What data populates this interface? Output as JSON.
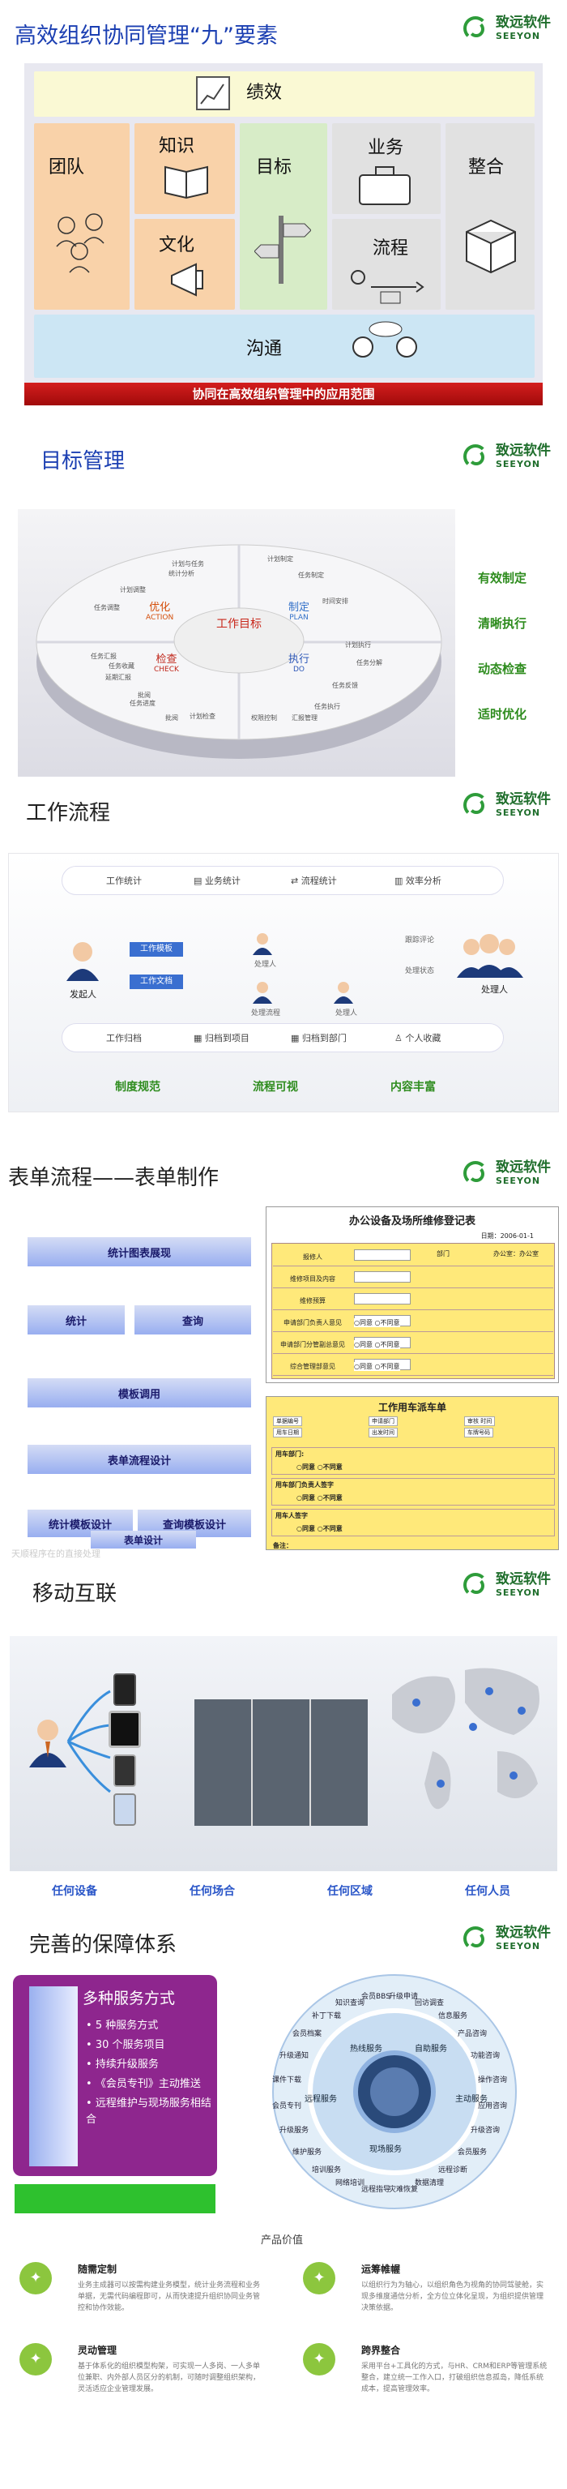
{
  "logo": {
    "cn": "致远软件",
    "en": "SEEYON"
  },
  "s1": {
    "title": "高效组织协同管理“九”要素",
    "perf": "绩效",
    "team": "团队",
    "knowledge": "知识",
    "culture": "文化",
    "goal": "目标",
    "business": "业务",
    "process": "流程",
    "integration": "整合",
    "comm": "沟通",
    "banner": "协同在高效组织管理中的应用范围"
  },
  "s2": {
    "title": "目标管理",
    "center": "工作目标",
    "optimize": "优化",
    "optimize_en": "ACTION",
    "plan": "制定",
    "plan_en": "PLAN",
    "check": "检查",
    "check_en": "CHECK",
    "execute": "执行",
    "execute_en": "DO",
    "labels": [
      "计划与任务",
      "统计分析",
      "计划调整",
      "任务调整",
      "任务汇报",
      "任务收藏",
      "延期汇报",
      "批阅",
      "任务进度",
      "批阅",
      "计划检查",
      "计划制定",
      "任务制定",
      "时间安排",
      "计划执行",
      "任务执行",
      "任务分解",
      "任务反馈",
      "汇报管理",
      "权限控制"
    ],
    "bullets": [
      "有效制定",
      "清晰执行",
      "动态检查",
      "适时优化"
    ]
  },
  "s3": {
    "title": "工作流程",
    "top": [
      "工作统计",
      "业务统计",
      "流程统计",
      "效率分析"
    ],
    "initiator": "发起人",
    "template": "工作模板",
    "doc": "工作文档",
    "handler1": "处理人",
    "handler2": "处理人",
    "handler3": "处理人",
    "handler4": "处理人",
    "process1": "处理流程",
    "process2": "处理状态",
    "process3": "跟踪评论",
    "bottom": [
      "工作归档",
      "归档到项目",
      "归档到部门",
      "个人收藏"
    ],
    "bullets": [
      "制度规范",
      "流程可视",
      "内容丰富"
    ]
  },
  "s4": {
    "title": "表单流程——表单制作",
    "p1": "统计图表展现",
    "p2a": "统计",
    "p2b": "查询",
    "p3": "模板调用",
    "p4": "表单流程设计",
    "p5a": "统计模板设计",
    "p5b": "查询模板设计",
    "p6": "表单设计",
    "ghost": "天顺程序在的直接处理",
    "form1": {
      "title": "办公设备及场所维修登记表",
      "rows": [
        "报修人",
        "维修项目及内容",
        "维修预算",
        "申请部门负责人意见",
        "申请部门分管副总意见",
        "综合管理部意见"
      ],
      "date": "日期：2006-01-1",
      "right": [
        "部门",
        "办公室：办公室"
      ],
      "approve": [
        "○同意 ○不同意",
        "○同意 ○不同意",
        "○同意 ○不同意"
      ]
    },
    "form2": {
      "title": "工作用车派车单",
      "rows": [
        "用车部门:",
        "用车部门负责人签字",
        "用车人签字"
      ],
      "fields": [
        "单据编号",
        "申请部门",
        "审核 时间",
        "用车日期",
        "出发时间",
        "车牌号码"
      ],
      "opts": [
        "○同意 ○不同意",
        "○同意 ○不同意",
        "○同意 ○不同意"
      ],
      "remark": "备注："
    }
  },
  "s5": {
    "title": "移动互联",
    "bullets": [
      "任何设备",
      "任何场合",
      "任何区域",
      "任何人员"
    ]
  },
  "s6": {
    "title": "完善的保障体系",
    "panel_title": "多种服务方式",
    "items": [
      "5 种服务方式",
      "30 个服务项目",
      "持续升级服务",
      "《会员专刊》主动推送",
      "远程维护与现场服务相结合"
    ],
    "ring_outer": [
      "会员档案",
      "补丁下载",
      "知识查询",
      "会员BBS",
      "升级申请",
      "回访调查",
      "信息服务",
      "产品咨询",
      "功能咨询",
      "操作咨询",
      "应用咨询",
      "升级咨询",
      "会员服务",
      "远程诊断",
      "数据清理",
      "灾难恢复",
      "远程指导",
      "网络培训",
      "培训服务",
      "维护服务",
      "升级服务",
      "会员专刊",
      "课件下载",
      "升级通知"
    ],
    "ring_inner": [
      "热线服务",
      "自助服务",
      "远程服务",
      "主动服务",
      "现场服务"
    ],
    "value_title": "产品价值",
    "values": [
      {
        "t": "随需定制",
        "d": "业务主成器可以按需构建业务模型，统计业务流程和业务单据，无需代码编程即可，从而快速提升组织协同业务管控和协作效能。"
      },
      {
        "t": "运筹帷幄",
        "d": "以组织行为为轴心，以组织角色为视角的协同驾驶舱，实现多维度通信分析，全方位立体化呈现，为组织提供管理决策依据。"
      },
      {
        "t": "灵动管理",
        "d": "基于体系化的组织模型构架，可实现一人多岗、一人多单位兼职、内外部人员区分的机制，可随时调整组织架构，灵活适应企业管理发展。"
      },
      {
        "t": "跨界整合",
        "d": "采用平台+工具化的方式，与HR、CRM和ERP等管理系统整合，建立统一工作入口，打破组织信息孤岛，降低系统成本，提高管理效率。"
      }
    ]
  }
}
